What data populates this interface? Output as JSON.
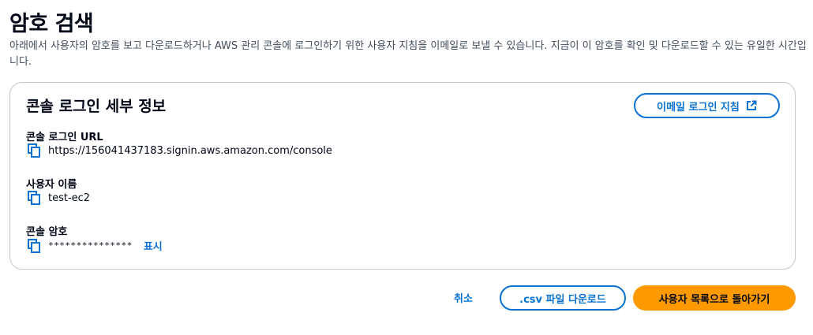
{
  "page": {
    "title": "암호 검색",
    "description": "아래에서 사용자의 암호를 보고 다운로드하거나 AWS 관리 콘솔에 로그인하기 위한 사용자 지침을 이메일로 보낼 수 있습니다. 지금이 이 암호를 확인 및 다운로드할 수 있는 유일한 시간입니다."
  },
  "panel": {
    "title": "콘솔 로그인 세부 정보",
    "email_button_label": "이메일 로그인 지침",
    "fields": {
      "url": {
        "label": "콘솔 로그인 URL",
        "value": "https://156041437183.signin.aws.amazon.com/console"
      },
      "username": {
        "label": "사용자 이름",
        "value": "test-ec2"
      },
      "password": {
        "label": "콘솔 암호",
        "value": "***************",
        "show_label": "표시"
      }
    }
  },
  "footer": {
    "cancel_label": "취소",
    "csv_label": ".csv 파일 다운로드",
    "primary_label": "사용자 목록으로 돌아가기"
  },
  "colors": {
    "accent": "#0972d3",
    "primary_button": "#ff9900",
    "text": "#000716",
    "secondary_text": "#414d5c",
    "border": "#c6c6cd"
  }
}
